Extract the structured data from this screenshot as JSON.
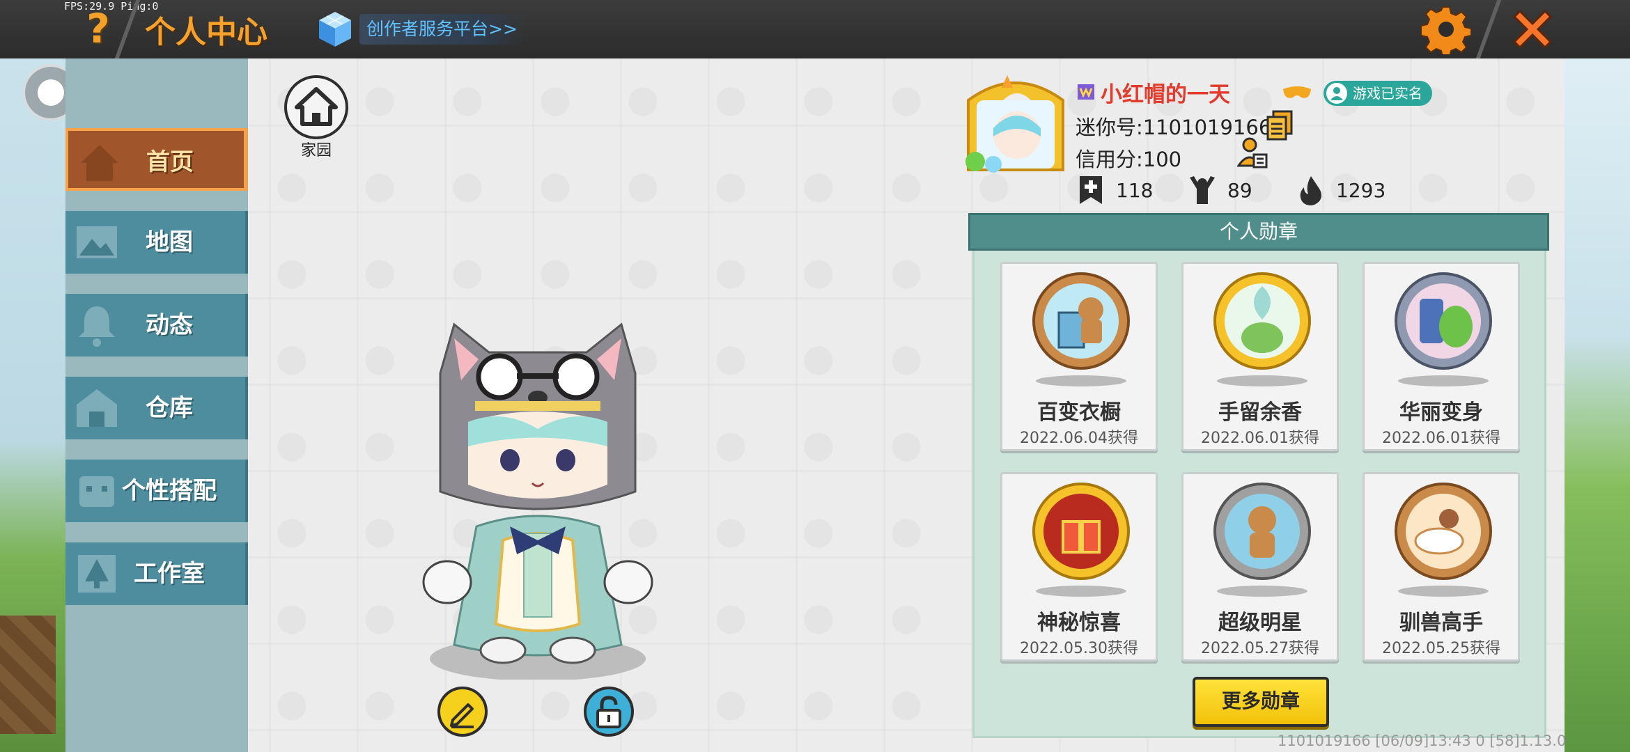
{
  "overlay": {
    "fps_text": "FPS:29.9  Ping:0"
  },
  "header": {
    "help_label": "?",
    "title": "个人中心",
    "creator_link": "创作者服务平台>>"
  },
  "nav": {
    "items": [
      {
        "label": "首页",
        "active": true
      },
      {
        "label": "地图",
        "active": false
      },
      {
        "label": "动态",
        "active": false
      },
      {
        "label": "仓库",
        "active": false
      },
      {
        "label": "个性搭配",
        "active": false
      },
      {
        "label": "工作室",
        "active": false
      }
    ]
  },
  "home": {
    "label": "家园"
  },
  "profile": {
    "nickname": "小红帽的一天",
    "realname_badge": "游戏已实名",
    "mini_id": "迷你号:1101019166",
    "credit": "信用分:100",
    "stats": {
      "add": "118",
      "fans": "89",
      "heat": "1293"
    }
  },
  "badges": {
    "header": "个人勋章",
    "items": [
      {
        "name": "百变衣橱",
        "date": "2022.06.04获得"
      },
      {
        "name": "手留余香",
        "date": "2022.06.01获得"
      },
      {
        "name": "华丽变身",
        "date": "2022.06.01获得"
      },
      {
        "name": "神秘惊喜",
        "date": "2022.05.30获得"
      },
      {
        "name": "超级明星",
        "date": "2022.05.27获得"
      },
      {
        "name": "驯兽高手",
        "date": "2022.05.25获得"
      }
    ],
    "more_label": "更多勋章"
  },
  "footer": {
    "info": "1101019166    [06/09]13:43 0  [58]1.13.0"
  },
  "colors": {
    "accent_orange": "#f6a12c",
    "nickname_red": "#e23b2b",
    "nav_teal": "#4e8d9d",
    "nav_active": "#a0552a",
    "badge_header": "#4f8e8a",
    "more_button": "#f5d01c"
  },
  "icons": {
    "help": "question-mark-icon",
    "creator": "cube-icon",
    "settings": "gear-icon",
    "close": "close-x-icon",
    "home": "house-icon",
    "edit": "pencil-icon",
    "lock": "lock-icon",
    "copy": "copy-icon",
    "friend": "add-friend-icon",
    "stat_add": "bookmark-plus-icon",
    "stat_fans": "cheering-person-icon",
    "stat_heat": "flame-icon"
  }
}
